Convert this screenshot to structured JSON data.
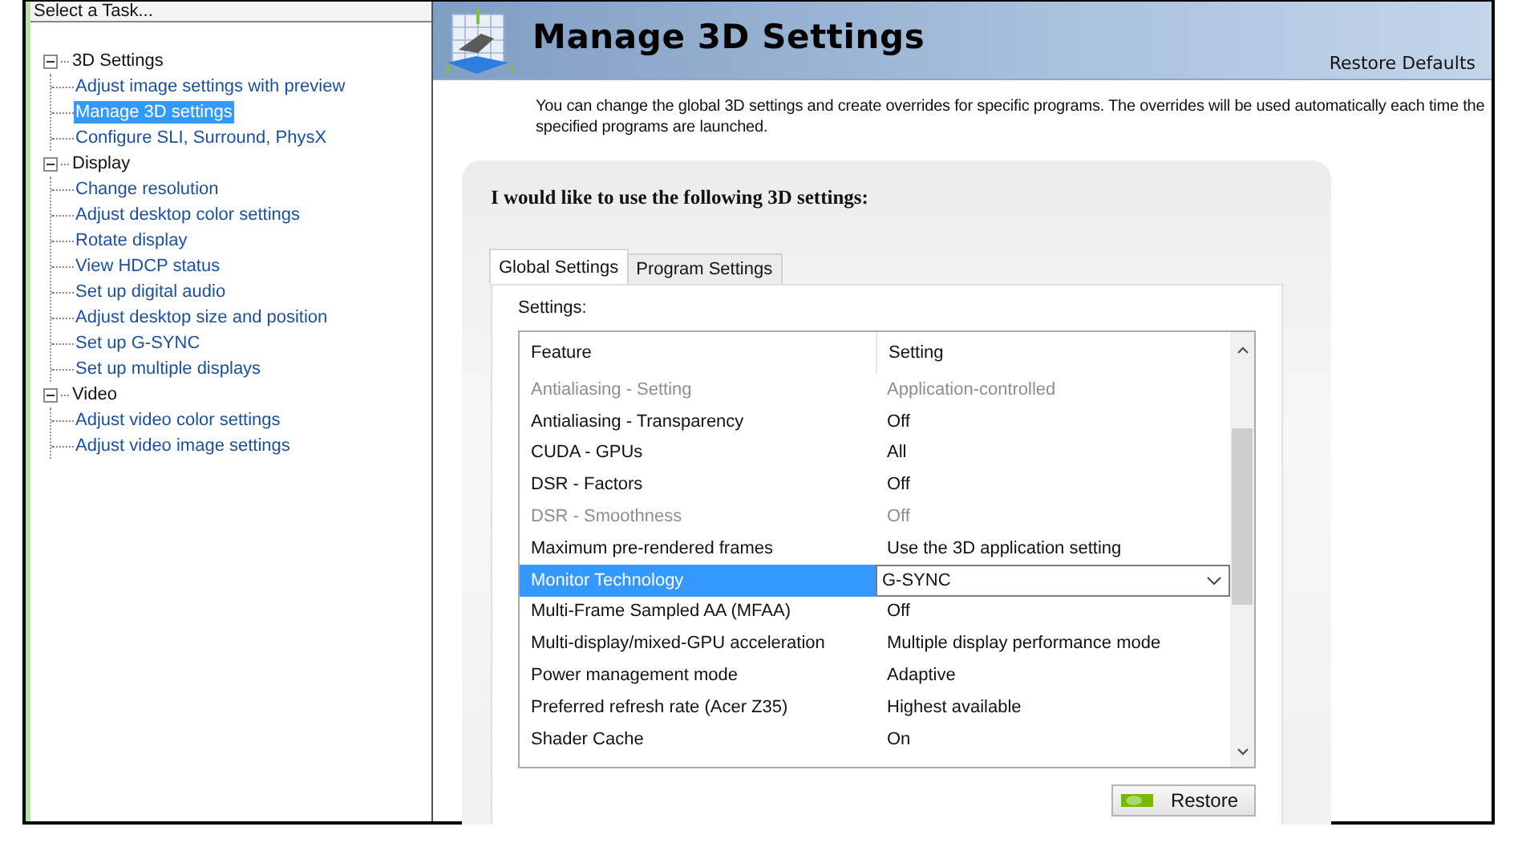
{
  "sidebar": {
    "title": "Select a Task...",
    "items": [
      {
        "label": "3D Settings",
        "expanded": true,
        "children": [
          {
            "label": "Adjust image settings with preview",
            "selected": false
          },
          {
            "label": "Manage 3D settings",
            "selected": true
          },
          {
            "label": "Configure SLI, Surround, PhysX",
            "selected": false
          }
        ]
      },
      {
        "label": "Display",
        "expanded": true,
        "children": [
          {
            "label": "Change resolution",
            "selected": false
          },
          {
            "label": "Adjust desktop color settings",
            "selected": false
          },
          {
            "label": "Rotate display",
            "selected": false
          },
          {
            "label": "View HDCP status",
            "selected": false
          },
          {
            "label": "Set up digital audio",
            "selected": false
          },
          {
            "label": "Adjust desktop size and position",
            "selected": false
          },
          {
            "label": "Set up G-SYNC",
            "selected": false
          },
          {
            "label": "Set up multiple displays",
            "selected": false
          }
        ]
      },
      {
        "label": "Video",
        "expanded": true,
        "children": [
          {
            "label": "Adjust video color settings",
            "selected": false
          },
          {
            "label": "Adjust video image settings",
            "selected": false
          }
        ]
      }
    ]
  },
  "header": {
    "title": "Manage 3D Settings",
    "restore_defaults": "Restore Defaults"
  },
  "description": "You can change the global 3D settings and create overrides for specific programs. The overrides will be used automatically each time the specified programs are launched.",
  "panel": {
    "heading": "I would like to use the following 3D settings:",
    "tabs": [
      {
        "label": "Global Settings",
        "selected": true
      },
      {
        "label": "Program Settings",
        "selected": false
      }
    ],
    "settings_label": "Settings:",
    "table": {
      "columns": [
        "Feature",
        "Setting"
      ],
      "rows": [
        {
          "feature": "Antialiasing - Setting",
          "setting": "Application-controlled",
          "disabled": true,
          "selected": false
        },
        {
          "feature": "Antialiasing - Transparency",
          "setting": "Off",
          "disabled": false,
          "selected": false
        },
        {
          "feature": "CUDA - GPUs",
          "setting": "All",
          "disabled": false,
          "selected": false
        },
        {
          "feature": "DSR - Factors",
          "setting": "Off",
          "disabled": false,
          "selected": false
        },
        {
          "feature": "DSR - Smoothness",
          "setting": "Off",
          "disabled": true,
          "selected": false
        },
        {
          "feature": "Maximum pre-rendered frames",
          "setting": "Use the 3D application setting",
          "disabled": false,
          "selected": false
        },
        {
          "feature": "Monitor Technology",
          "setting": "G-SYNC",
          "disabled": false,
          "selected": true
        },
        {
          "feature": "Multi-Frame Sampled AA (MFAA)",
          "setting": "Off",
          "disabled": false,
          "selected": false
        },
        {
          "feature": "Multi-display/mixed-GPU acceleration",
          "setting": "Multiple display performance mode",
          "disabled": false,
          "selected": false
        },
        {
          "feature": "Power management mode",
          "setting": "Adaptive",
          "disabled": false,
          "selected": false
        },
        {
          "feature": "Preferred refresh rate (Acer Z35)",
          "setting": "Highest available",
          "disabled": false,
          "selected": false
        },
        {
          "feature": "Shader Cache",
          "setting": "On",
          "disabled": false,
          "selected": false
        }
      ]
    },
    "restore_button": "Restore"
  }
}
